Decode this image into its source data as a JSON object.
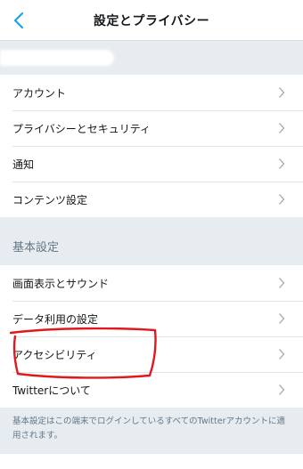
{
  "nav": {
    "title": "設定とプライバシー",
    "back_icon": "chevron-left-icon",
    "accent_color": "#1da1f2"
  },
  "account_group": {
    "items": [
      {
        "label": "アカウント"
      },
      {
        "label": "プライバシーとセキュリティ"
      },
      {
        "label": "通知"
      },
      {
        "label": "コンテンツ設定"
      }
    ]
  },
  "general": {
    "header": "基本設定",
    "items": [
      {
        "label": "画面表示とサウンド"
      },
      {
        "label": "データ利用の設定"
      },
      {
        "label": "アクセシビリティ"
      },
      {
        "label": "Twitterについて"
      }
    ],
    "footer": "基本設定はこの端末でログインしているすべてのTwitterアカウントに適用されます。"
  },
  "annotation_color": "#e0191e"
}
